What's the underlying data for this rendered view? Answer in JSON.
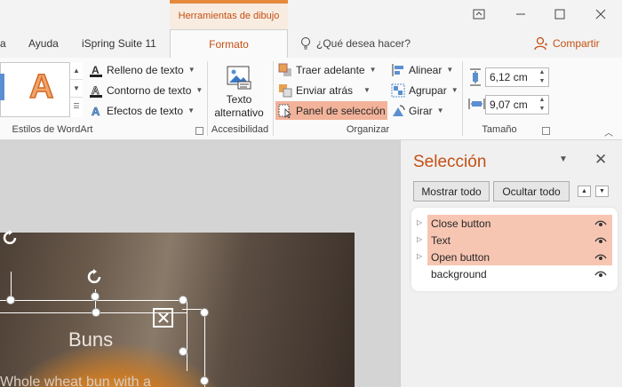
{
  "contextual_tab_group": "Herramientas de dibujo",
  "tabs": [
    {
      "label": "a"
    },
    {
      "label": "Ayuda"
    },
    {
      "label": "iSpring Suite 11"
    },
    {
      "label": "Formato"
    }
  ],
  "tell_me": "¿Qué desea hacer?",
  "share": "Compartir",
  "ribbon": {
    "wordart": {
      "sample_letter": "A",
      "fill": "Relleno de texto",
      "outline": "Contorno de texto",
      "effects": "Efectos de texto",
      "group_label": "Estilos de WordArt"
    },
    "accessibility": {
      "alt_text_line1": "Texto",
      "alt_text_line2": "alternativo",
      "group_label": "Accesibilidad"
    },
    "arrange": {
      "bring_forward": "Traer adelante",
      "send_backward": "Enviar atrás",
      "selection_pane": "Panel de selección",
      "align": "Alinear",
      "group": "Agrupar",
      "rotate": "Girar",
      "group_label": "Organizar"
    },
    "size": {
      "height": "6,12 cm",
      "width": "9,07 cm",
      "group_label": "Tamaño"
    }
  },
  "slide": {
    "title": "Buns",
    "subtitle": "Whole wheat bun with a"
  },
  "selection_pane": {
    "title": "Selección",
    "show_all": "Mostrar todo",
    "hide_all": "Ocultar todo",
    "items": [
      {
        "name": "Close button",
        "highlighted": true,
        "expandable": true
      },
      {
        "name": "Text",
        "highlighted": true,
        "expandable": true
      },
      {
        "name": "Open button",
        "highlighted": true,
        "expandable": true
      },
      {
        "name": "background",
        "highlighted": false,
        "expandable": false
      }
    ]
  },
  "colors": {
    "accent": "#c44f12",
    "highlight": "#f7c6b3"
  }
}
